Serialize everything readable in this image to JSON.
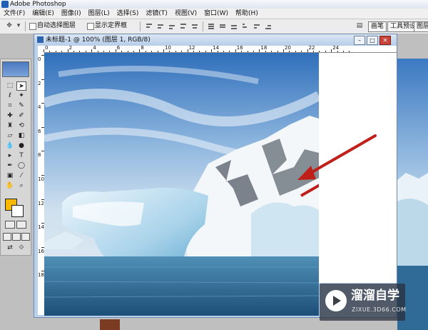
{
  "window": {
    "title": "Adobe Photoshop"
  },
  "menu": [
    "文件(F)",
    "编辑(E)",
    "图像(I)",
    "图层(L)",
    "选择(S)",
    "滤镜(T)",
    "视图(V)",
    "窗口(W)",
    "帮助(H)"
  ],
  "options_bar": {
    "auto_select_label": "自动选择图层",
    "auto_select_checked": false,
    "show_bounds_label": "显示定界框",
    "show_bounds_checked": false,
    "tabs": [
      "画笔",
      "工具预设",
      "图层复合"
    ]
  },
  "toolbox": {
    "foreground_color": "#f6b800",
    "background_color": "#ffffff"
  },
  "document": {
    "title": "未标题-1 @ 100% (图层 1, RGB/8)",
    "ruler_top": [
      "0",
      "2",
      "4",
      "6",
      "8",
      "10",
      "12",
      "14",
      "16",
      "18",
      "20",
      "22",
      "24"
    ],
    "ruler_left": [
      "0",
      "2",
      "4",
      "6",
      "8",
      "10",
      "12",
      "14",
      "16",
      "18"
    ]
  },
  "watermark": {
    "title": "溜溜自学",
    "url": "ZIXUE.3D66.COM"
  },
  "colors": {
    "arrow": "#c0201a",
    "accent": "#2e63b0"
  }
}
